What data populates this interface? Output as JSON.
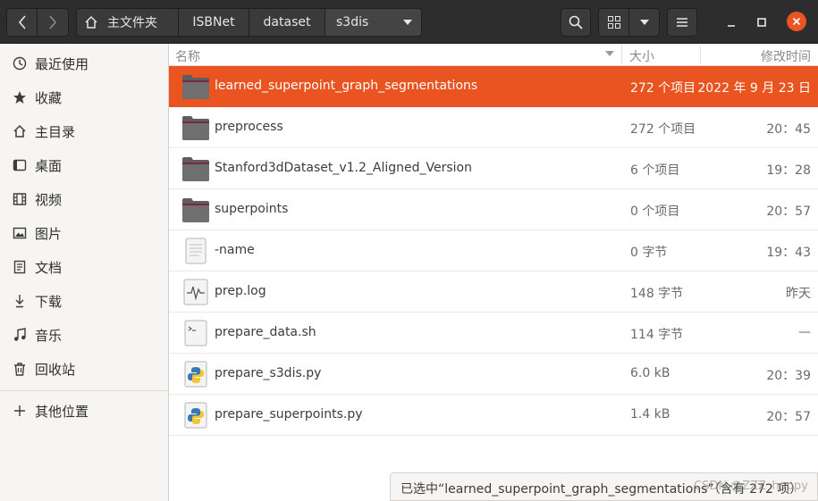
{
  "path": {
    "home_label": "主文件夹",
    "crumbs": [
      "ISBNet",
      "dataset",
      "s3dis"
    ]
  },
  "sidebar": {
    "items": [
      {
        "label": "最近使用",
        "icon": "clock-icon"
      },
      {
        "label": "收藏",
        "icon": "star-icon"
      },
      {
        "label": "主目录",
        "icon": "home-icon"
      },
      {
        "label": "桌面",
        "icon": "desktop-icon"
      },
      {
        "label": "视频",
        "icon": "video-icon"
      },
      {
        "label": "图片",
        "icon": "picture-icon"
      },
      {
        "label": "文档",
        "icon": "document-icon"
      },
      {
        "label": "下载",
        "icon": "download-icon"
      },
      {
        "label": "音乐",
        "icon": "music-icon"
      },
      {
        "label": "回收站",
        "icon": "trash-icon"
      },
      {
        "label": "其他位置",
        "icon": "plus-icon"
      }
    ]
  },
  "columns": {
    "name": "名称",
    "size": "大小",
    "modified": "修改时间"
  },
  "files": [
    {
      "name": "learned_superpoint_graph_segmentations",
      "size": "272 个项目",
      "modified": "2022 年 9 月 23 日",
      "type": "folder",
      "selected": true
    },
    {
      "name": "preprocess",
      "size": "272 个项目",
      "modified": "20：45",
      "type": "folder"
    },
    {
      "name": "Stanford3dDataset_v1.2_Aligned_Version",
      "size": "6 个项目",
      "modified": "19：28",
      "type": "folder"
    },
    {
      "name": "superpoints",
      "size": "0 个项目",
      "modified": "20：57",
      "type": "folder"
    },
    {
      "name": "-name",
      "size": "0 字节",
      "modified": "19：43",
      "type": "text"
    },
    {
      "name": "prep.log",
      "size": "148 字节",
      "modified": "昨天",
      "type": "log"
    },
    {
      "name": "prepare_data.sh",
      "size": "114 字节",
      "modified": "—",
      "type": "script"
    },
    {
      "name": "prepare_s3dis.py",
      "size": "6.0 kB",
      "modified": "20：39",
      "type": "python"
    },
    {
      "name": "prepare_superpoints.py",
      "size": "1.4 kB",
      "modified": "20：57",
      "type": "python"
    }
  ],
  "status": "已选中“learned_superpoint_graph_segmentations”（含有 272 项）",
  "watermark": "CSDN @ZZZ_happy",
  "colors": {
    "accent": "#e95420",
    "header": "#2d2d2d",
    "sidebar": "#f6f5f4"
  }
}
